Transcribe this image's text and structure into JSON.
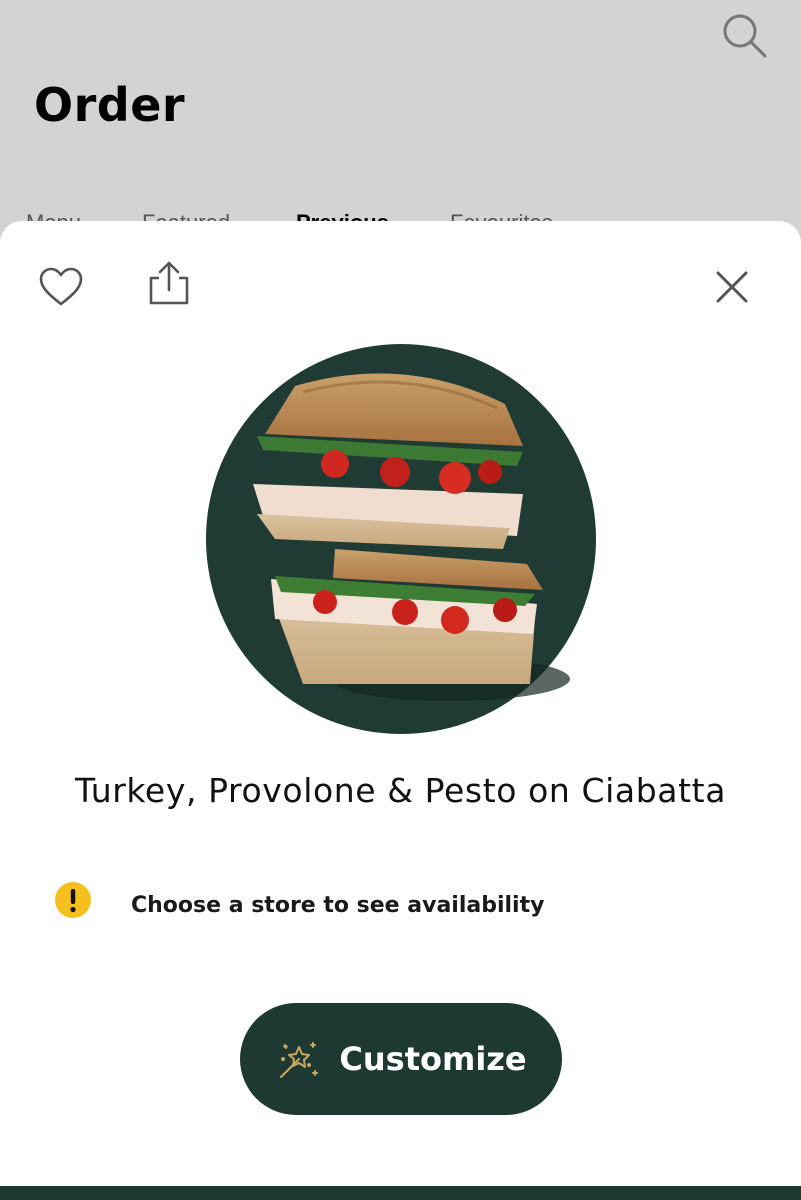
{
  "header": {
    "title": "Order",
    "tabs": [
      {
        "label": "Menu"
      },
      {
        "label": "Featured"
      },
      {
        "label": "Previous"
      },
      {
        "label": "Favourites"
      }
    ]
  },
  "icons": {
    "search": "search-icon",
    "favorite": "heart-icon",
    "share": "share-icon",
    "close": "close-icon",
    "notice": "exclamation-icon",
    "customize": "magic-wand-icon"
  },
  "product": {
    "name": "Turkey, Provolone & Pesto on Ciabatta",
    "image": "sandwich-photo"
  },
  "availability": {
    "message": "Choose a store to see availability"
  },
  "actions": {
    "customize_label": "Customize"
  },
  "colors": {
    "brand_green": "#1e3932",
    "notice_yellow": "#f5bf1d",
    "wand_gold": "#c8a765",
    "overlay_gray": "#d3d3d3"
  }
}
